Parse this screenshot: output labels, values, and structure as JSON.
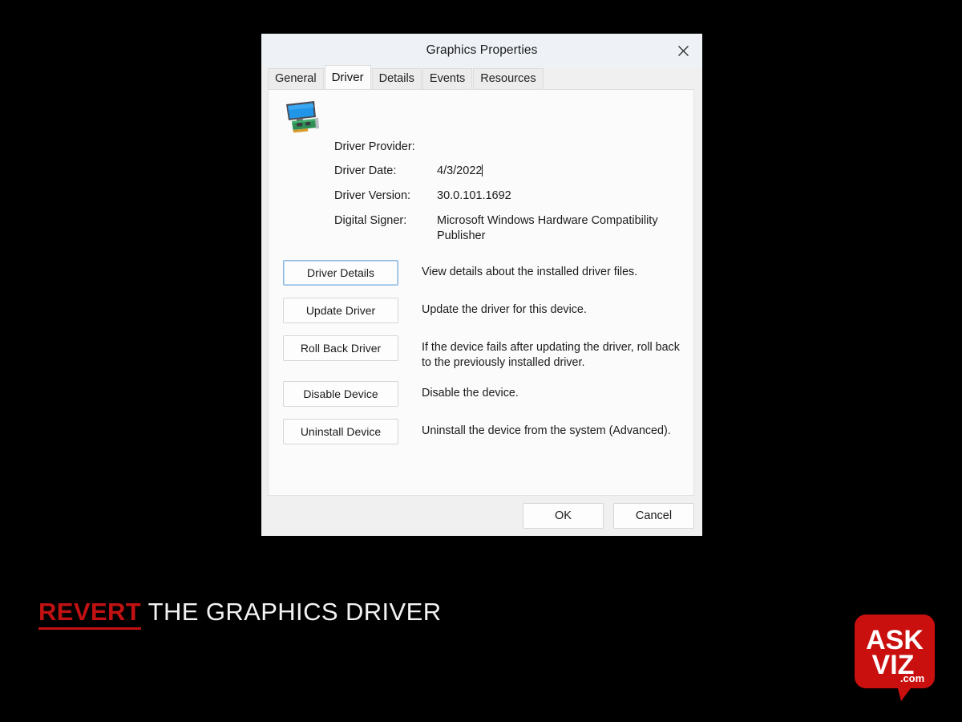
{
  "dialog": {
    "title": "Graphics Properties",
    "close_icon": "close-icon",
    "tabs": [
      {
        "label": "General",
        "active": false
      },
      {
        "label": "Driver",
        "active": true
      },
      {
        "label": "Details",
        "active": false
      },
      {
        "label": "Events",
        "active": false
      },
      {
        "label": "Resources",
        "active": false
      }
    ],
    "device_icon": "graphics-adapter-icon",
    "info": [
      {
        "label": "Driver Provider:",
        "value": ""
      },
      {
        "label": "Driver Date:",
        "value": "4/3/2022",
        "caret": true
      },
      {
        "label": "Driver Version:",
        "value": "30.0.101.1692"
      },
      {
        "label": "Digital Signer:",
        "value": "Microsoft Windows Hardware Compatibility Publisher"
      }
    ],
    "actions": [
      {
        "button": "Driver Details",
        "description": "View details about the installed driver files.",
        "focused": true
      },
      {
        "button": "Update Driver",
        "description": "Update the driver for this device.",
        "focused": false
      },
      {
        "button": "Roll Back Driver",
        "description": "If the device fails after updating the driver, roll back to the previously installed driver.",
        "focused": false
      },
      {
        "button": "Disable Device",
        "description": "Disable the device.",
        "focused": false
      },
      {
        "button": "Uninstall Device",
        "description": "Uninstall the device from the system (Advanced).",
        "focused": false
      }
    ],
    "footer": {
      "ok_label": "OK",
      "cancel_label": "Cancel"
    }
  },
  "caption": {
    "accent": "REVERT",
    "rest": " THE GRAPHICS DRIVER",
    "accent_color": "#c21112",
    "text_color": "#f2f2f2"
  },
  "logo": {
    "line1": "ASK",
    "line2": "VIZ",
    "line3": ".com",
    "background_color": "#c9100f",
    "text_color": "#ffffff"
  },
  "background_color": "#000000"
}
